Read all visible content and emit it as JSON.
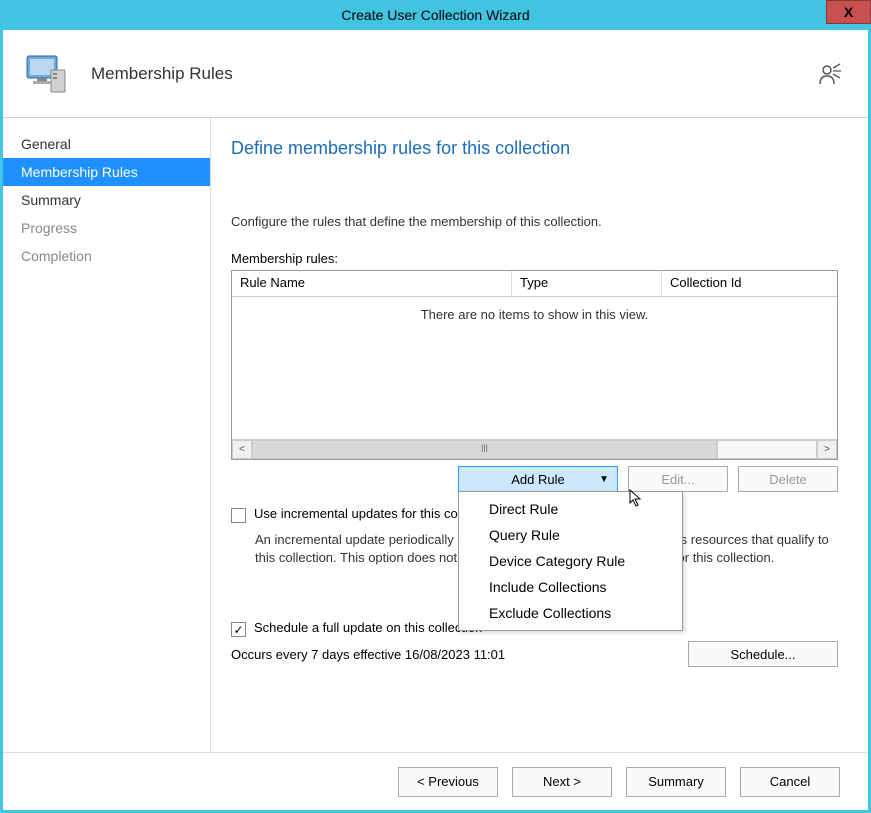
{
  "window": {
    "title": "Create User Collection Wizard",
    "close": "X"
  },
  "header": {
    "title": "Membership Rules"
  },
  "sidebar": {
    "items": [
      {
        "label": "General"
      },
      {
        "label": "Membership Rules"
      },
      {
        "label": "Summary"
      },
      {
        "label": "Progress"
      },
      {
        "label": "Completion"
      }
    ]
  },
  "main": {
    "heading": "Define membership rules for this collection",
    "instruction": "Configure the rules that define the membership of this collection.",
    "rules_label": "Membership rules:",
    "columns": {
      "name": "Rule Name",
      "type": "Type",
      "collection_id": "Collection Id"
    },
    "empty_text": "There are no items to show in this view.",
    "buttons": {
      "add_rule": "Add Rule",
      "edit": "Edit...",
      "delete": "Delete"
    },
    "dropdown": [
      "Direct Rule",
      "Query Rule",
      "Device Category Rule",
      "Include Collections",
      "Exclude Collections"
    ],
    "incremental": {
      "checkbox_label": "Use incremental updates for this collection",
      "description": "An incremental update periodically evaluates new resources and then adds resources that qualify to this collection. This option does not require you to schedule a full update for this collection."
    },
    "schedule": {
      "checkbox_label": "Schedule a full update on this collection",
      "occurs": "Occurs every 7 days effective 16/08/2023 11:01",
      "button": "Schedule..."
    }
  },
  "footer": {
    "previous": "< Previous",
    "next": "Next >",
    "summary": "Summary",
    "cancel": "Cancel"
  }
}
